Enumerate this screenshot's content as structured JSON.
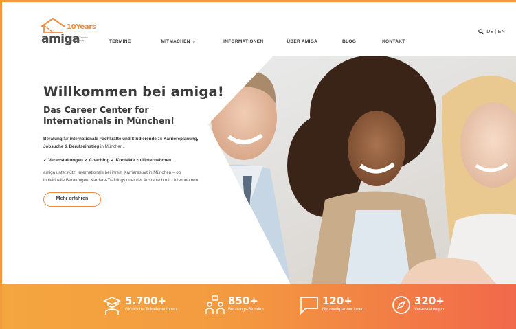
{
  "logo": {
    "word": "amiga",
    "years": "10Years",
    "tagline": "Career Center for Internationals"
  },
  "nav": {
    "items": [
      {
        "label": "TERMINE"
      },
      {
        "label": "MITMACHEN",
        "has_dropdown": true
      },
      {
        "label": "INFORMATIONEN"
      },
      {
        "label": "ÜBER AMIGA"
      },
      {
        "label": "BLOG"
      },
      {
        "label": "KONTAKT"
      }
    ]
  },
  "lang": {
    "de": "DE",
    "sep": "|",
    "en": "EN"
  },
  "hero": {
    "title": "Willkommen bei amiga!",
    "subtitle": "Das Career Center for Internationals in München!",
    "intro_b1": "Beratung",
    "intro_t1": " für ",
    "intro_b2": "internationale Fachkräfte und Studierende",
    "intro_t2": " zu ",
    "intro_b3": "Karriereplanung, Jobsuche & Berufseinstieg",
    "intro_t3": " in München.",
    "highlights": "✓ Veranstaltungen ✓ Coaching ✓ Kontakte zu Unternehmen",
    "body": "amiga unterstützt Internationals bei ihrem Karrierestart in München – ob individuelle Beratungen, Karriere-Trainings oder der Austausch mit Unternehmen.",
    "cta": "Mehr erfahren"
  },
  "stats": [
    {
      "icon": "graduate-icon",
      "number": "5.700+",
      "label": "Glückliche Teilnehmer:innen"
    },
    {
      "icon": "consulting-icon",
      "number": "850+",
      "label": "Beratungs-Stunden"
    },
    {
      "icon": "speech-bubble-icon",
      "number": "120+",
      "label": "Netzwerkpartner:innen"
    },
    {
      "icon": "compass-icon",
      "number": "320+",
      "label": "Veranstaltungen"
    }
  ],
  "colors": {
    "accent": "#f08a3e",
    "stats_gradient_start": "#f4a63f",
    "stats_gradient_end": "#f1694b",
    "text_dark": "#3b3b3b"
  }
}
